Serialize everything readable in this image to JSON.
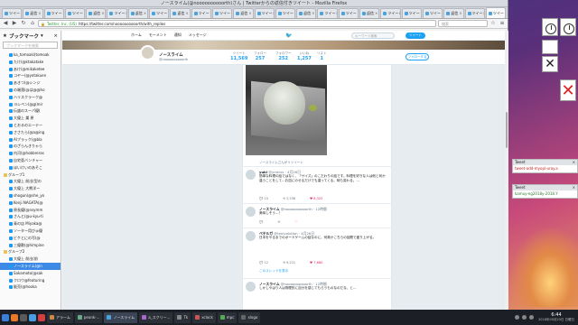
{
  "window": {
    "title": "ノースライム(@noooooooooorth)さん | Twitterからの返信付きツイート - Mozilla Firefox"
  },
  "tabs": [
    {
      "label": "ツイート"
    },
    {
      "label": "返信"
    },
    {
      "label": "ツイート"
    },
    {
      "label": "ツイート"
    },
    {
      "label": "返信"
    },
    {
      "label": "ツイート"
    },
    {
      "label": "返信"
    },
    {
      "label": "ツイート"
    },
    {
      "label": "返信"
    },
    {
      "label": "ツイート"
    },
    {
      "label": "ツイート"
    },
    {
      "label": "返信"
    },
    {
      "label": "ツイート"
    },
    {
      "label": "ツイート"
    },
    {
      "label": "返信"
    },
    {
      "label": "ツイート"
    },
    {
      "label": "ツイート"
    },
    {
      "label": "返信"
    },
    {
      "label": "ツイート"
    },
    {
      "label": "ツイート"
    },
    {
      "label": "ツイート"
    },
    {
      "label": "返信"
    },
    {
      "label": "ツイート"
    },
    {
      "label": "ツイート"
    }
  ],
  "navbar": {
    "org": "Twitter, Inc. (US)",
    "url": "https://twitter.com/noooooooooorth/with_replies",
    "search_placeholder": "検索"
  },
  "sidebar": {
    "title": "ブックマーク",
    "close": "×",
    "search_placeholder": "ブックマークを検索",
    "items": [
      {
        "label": "ka_tomoaki(tomoak",
        "type": "bookmark",
        "selected": false
      },
      {
        "label": "たけ(@ktakatake",
        "type": "bookmark",
        "selected": false
      },
      {
        "label": "あけ(@mikaketee",
        "type": "bookmark",
        "selected": false
      },
      {
        "label": "コヤー(@yotakuen",
        "type": "bookmark",
        "selected": false
      },
      {
        "label": "あきつ(@シンジ",
        "type": "bookmark",
        "selected": false
      },
      {
        "label": "の端落(@は@@ho",
        "type": "bookmark",
        "selected": false
      },
      {
        "label": "ハリスクラーク@",
        "type": "bookmark",
        "selected": false
      },
      {
        "label": "ヨシペン(@g(mir",
        "type": "bookmark",
        "selected": false
      },
      {
        "label": "伝盛のスーパ優(",
        "type": "bookmark",
        "selected": false
      },
      {
        "label": "大優上 巣 原",
        "type": "bookmark",
        "selected": false
      },
      {
        "label": "とおるのエーテー",
        "type": "bookmark",
        "selected": false
      },
      {
        "label": "ささたら(@a@ing",
        "type": "bookmark",
        "selected": false
      },
      {
        "label": "AIプラック(@bla",
        "type": "bookmark",
        "selected": false
      },
      {
        "label": "のざらんきりゃら",
        "type": "bookmark",
        "selected": false
      },
      {
        "label": "内河(@hobbreras",
        "type": "bookmark",
        "selected": false
      },
      {
        "label": "自宅亜バンチャー",
        "type": "bookmark",
        "selected": false
      },
      {
        "label": "ほいけいのあそこ",
        "type": "bookmark",
        "selected": false
      },
      {
        "label": "グループ1",
        "type": "folder",
        "selected": false
      },
      {
        "label": "大優上 前出(型の",
        "type": "bookmark",
        "selected": false
      },
      {
        "label": "大優上 大熊洋ー",
        "type": "bookmark",
        "selected": false
      },
      {
        "label": "shogun(@she_yo",
        "type": "bookmark",
        "selected": false
      },
      {
        "label": "Kenji NAGATA(@",
        "type": "bookmark",
        "selected": false
      },
      {
        "label": "原長優(@nsymm",
        "type": "bookmark",
        "selected": false
      },
      {
        "label": "さんと(@u-kyu-ti",
        "type": "bookmark",
        "selected": false
      },
      {
        "label": "青の店 Miyaka@",
        "type": "bookmark",
        "selected": false
      },
      {
        "label": "ソーター用びゅ優",
        "type": "bookmark",
        "selected": false
      },
      {
        "label": "ビケとにの写(@",
        "type": "bookmark",
        "selected": false
      },
      {
        "label": "三優歌(@himpine",
        "type": "bookmark",
        "selected": false
      },
      {
        "label": "グループ2",
        "type": "folder",
        "selected": false
      },
      {
        "label": "大優上 前出(前",
        "type": "bookmark",
        "selected": false
      },
      {
        "label": "ノースライム(@n",
        "type": "bookmark",
        "selected": true
      },
      {
        "label": "Sakamoto(@sak",
        "type": "bookmark",
        "selected": false
      },
      {
        "label": "クロウ@featuring",
        "type": "bookmark",
        "selected": false
      },
      {
        "label": "販売(@hooka",
        "type": "bookmark",
        "selected": false
      }
    ]
  },
  "twitter": {
    "nav": [
      "ホーム",
      "モーメント",
      "通知",
      "メッセージ"
    ],
    "search_placeholder": "キーワード検索",
    "tweet_button": "ツイート",
    "profile": {
      "name": "ノースライム",
      "handle": "@noooooooooorth"
    },
    "stats": [
      {
        "label": "ツイート",
        "value": "11,569"
      },
      {
        "label": "フォロー",
        "value": "257"
      },
      {
        "label": "フォロワー",
        "value": "252"
      },
      {
        "label": "いいね",
        "value": "1,257"
      },
      {
        "label": "リスト",
        "value": "1"
      }
    ],
    "follow_button": "フォローする",
    "retweet_label": "ノースライムさんがリツイート",
    "tweets": [
      {
        "name": "yuki",
        "handle": "@ymtnrs · 4月26日",
        "text": "簡単な料理の話ではなく、「サイズ」のこだわりの話です。料理を好きな人は他と何か違うことをして…お皿にのせるだけでも違ってくる。味も変わる。…",
        "replies": "15",
        "retweets": "3,336",
        "likes": "8,322"
      },
      {
        "name": "ノースライム",
        "handle": "@noooooooooorth · 12時間",
        "text": "美味しそう…！",
        "replies": "",
        "retweets": "",
        "likes": ""
      },
      {
        "name": "ベテルガ",
        "handle": "@tenlvolution · 4月26日",
        "text": "日本をやるまでのボードゲームの話なのに、何故かこちらの話題で盛り上がる。",
        "replies": "12",
        "retweets": "9,221",
        "likes": "7,680"
      },
      {
        "name": "ノースライム",
        "handle": "@noooooooooorth · 12時間",
        "text": "しかしやはり人は物理的に自分を感じてもらうものなのだな、と…",
        "replies": "",
        "retweets": "",
        "likes": ""
      }
    ],
    "show_thread": "このスレッドを表示"
  },
  "notifications": [
    {
      "title": "Tweet",
      "body": "tweet-add-myopl-uray.a",
      "color": "#c51d1d"
    },
    {
      "title": "Tweet",
      "body": "kamuy-eg2018y-2018.Y",
      "color": "#2f7a2f"
    }
  ],
  "taskbar": {
    "tasks": [
      {
        "label": "アラーム"
      },
      {
        "label": "peonk-..."
      },
      {
        "label": "ノースライム"
      },
      {
        "label": "a_スクリー..."
      },
      {
        "label": "Tk"
      },
      {
        "label": "xclock"
      },
      {
        "label": "mpc"
      },
      {
        "label": "xlogo"
      }
    ],
    "time": "6:44",
    "date": "2018年05月20日 日曜日"
  }
}
